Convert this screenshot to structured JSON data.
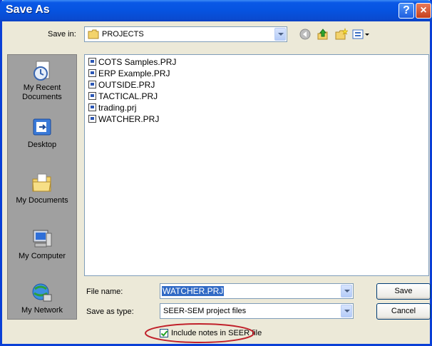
{
  "window": {
    "title": "Save As",
    "help_label": "?",
    "close_label": "×"
  },
  "save_in": {
    "label": "Save in:",
    "value": "PROJECTS"
  },
  "toolbar": {
    "icons": [
      "back-icon",
      "up-folder-icon",
      "new-folder-icon",
      "views-menu-icon"
    ]
  },
  "places": [
    {
      "label": "My Recent Documents",
      "icon": "recent-documents-icon"
    },
    {
      "label": "Desktop",
      "icon": "desktop-icon"
    },
    {
      "label": "My Documents",
      "icon": "my-documents-icon"
    },
    {
      "label": "My Computer",
      "icon": "my-computer-icon"
    },
    {
      "label": "My Network",
      "icon": "my-network-icon"
    }
  ],
  "files": [
    "COTS Samples.PRJ",
    "ERP Example.PRJ",
    "OUTSIDE.PRJ",
    "TACTICAL.PRJ",
    "trading.prj",
    "WATCHER.PRJ"
  ],
  "file_name": {
    "label": "File name:",
    "value": "WATCHER.PRJ"
  },
  "save_as_type": {
    "label": "Save as type:",
    "value": "SEER-SEM project files"
  },
  "buttons": {
    "save": "Save",
    "cancel": "Cancel"
  },
  "include_notes": {
    "label": "Include notes in SEER file",
    "checked": true
  },
  "colors": {
    "title_bar": "#0a58e6",
    "dialog_bg": "#ece9d8",
    "selection": "#316ac5",
    "highlight_ellipse": "#c0202a"
  }
}
